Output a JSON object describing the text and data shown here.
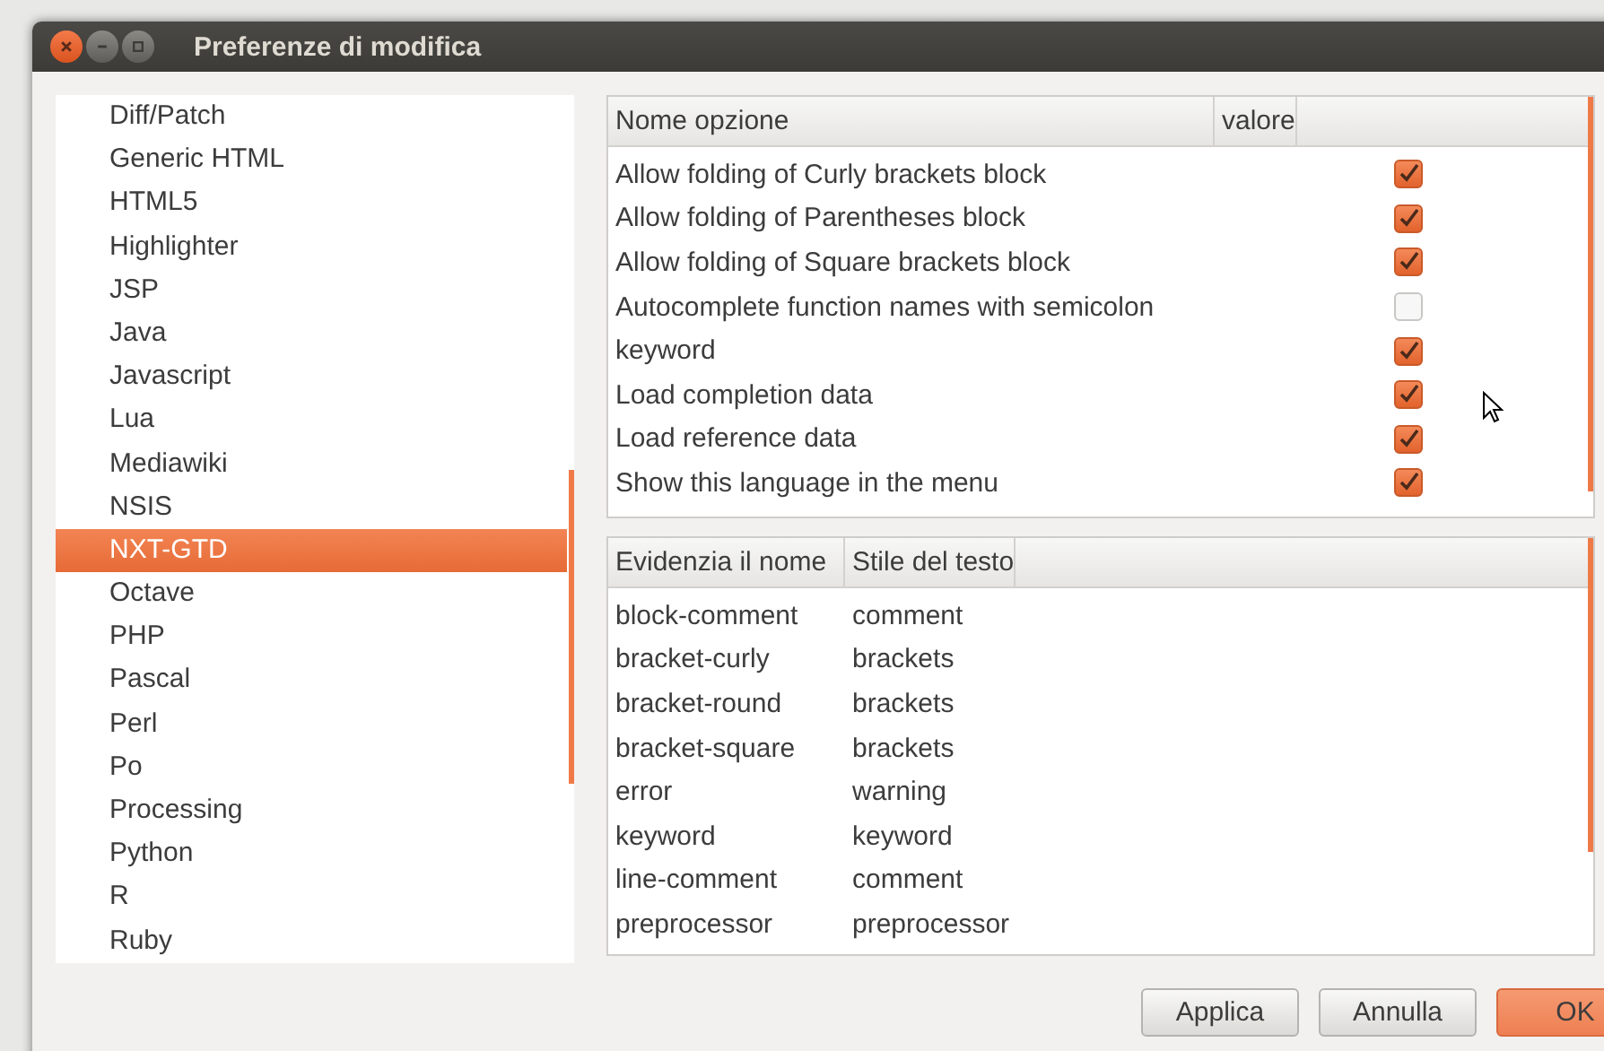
{
  "window": {
    "title": "Preferenze di modifica"
  },
  "languages": [
    {
      "label": "Diff/Patch",
      "selected": false
    },
    {
      "label": "Generic HTML",
      "selected": false
    },
    {
      "label": "HTML5",
      "selected": false
    },
    {
      "label": "Highlighter",
      "selected": false
    },
    {
      "label": "JSP",
      "selected": false
    },
    {
      "label": "Java",
      "selected": false
    },
    {
      "label": "Javascript",
      "selected": false
    },
    {
      "label": "Lua",
      "selected": false
    },
    {
      "label": "Mediawiki",
      "selected": false
    },
    {
      "label": "NSIS",
      "selected": false
    },
    {
      "label": "NXT-GTD",
      "selected": true
    },
    {
      "label": "Octave",
      "selected": false
    },
    {
      "label": "PHP",
      "selected": false
    },
    {
      "label": "Pascal",
      "selected": false
    },
    {
      "label": "Perl",
      "selected": false
    },
    {
      "label": "Po",
      "selected": false
    },
    {
      "label": "Processing",
      "selected": false
    },
    {
      "label": "Python",
      "selected": false
    },
    {
      "label": "R",
      "selected": false
    },
    {
      "label": "Ruby",
      "selected": false
    }
  ],
  "options_table": {
    "columns": [
      "Nome opzione",
      "valore"
    ],
    "rows": [
      {
        "name": "Allow folding of Curly brackets block",
        "checked": true
      },
      {
        "name": "Allow folding of Parentheses block",
        "checked": true
      },
      {
        "name": "Allow folding of Square brackets block",
        "checked": true
      },
      {
        "name": "Autocomplete function names with semicolon",
        "checked": false
      },
      {
        "name": "keyword",
        "checked": true
      },
      {
        "name": "Load completion data",
        "checked": true
      },
      {
        "name": "Load reference data",
        "checked": true
      },
      {
        "name": "Show this language in the menu",
        "checked": true
      }
    ]
  },
  "styles_table": {
    "columns": [
      "Evidenzia il nome",
      "Stile del testo"
    ],
    "rows": [
      [
        "block-comment",
        "comment"
      ],
      [
        "bracket-curly",
        "brackets"
      ],
      [
        "bracket-round",
        "brackets"
      ],
      [
        "bracket-square",
        "brackets"
      ],
      [
        "error",
        "warning"
      ],
      [
        "keyword",
        "keyword"
      ],
      [
        "line-comment",
        "comment"
      ],
      [
        "preprocessor",
        "preprocessor"
      ]
    ]
  },
  "buttons": [
    {
      "label": "Applica",
      "kind": "normal"
    },
    {
      "label": "Annulla",
      "kind": "normal"
    },
    {
      "label": "OK",
      "kind": "default"
    }
  ]
}
